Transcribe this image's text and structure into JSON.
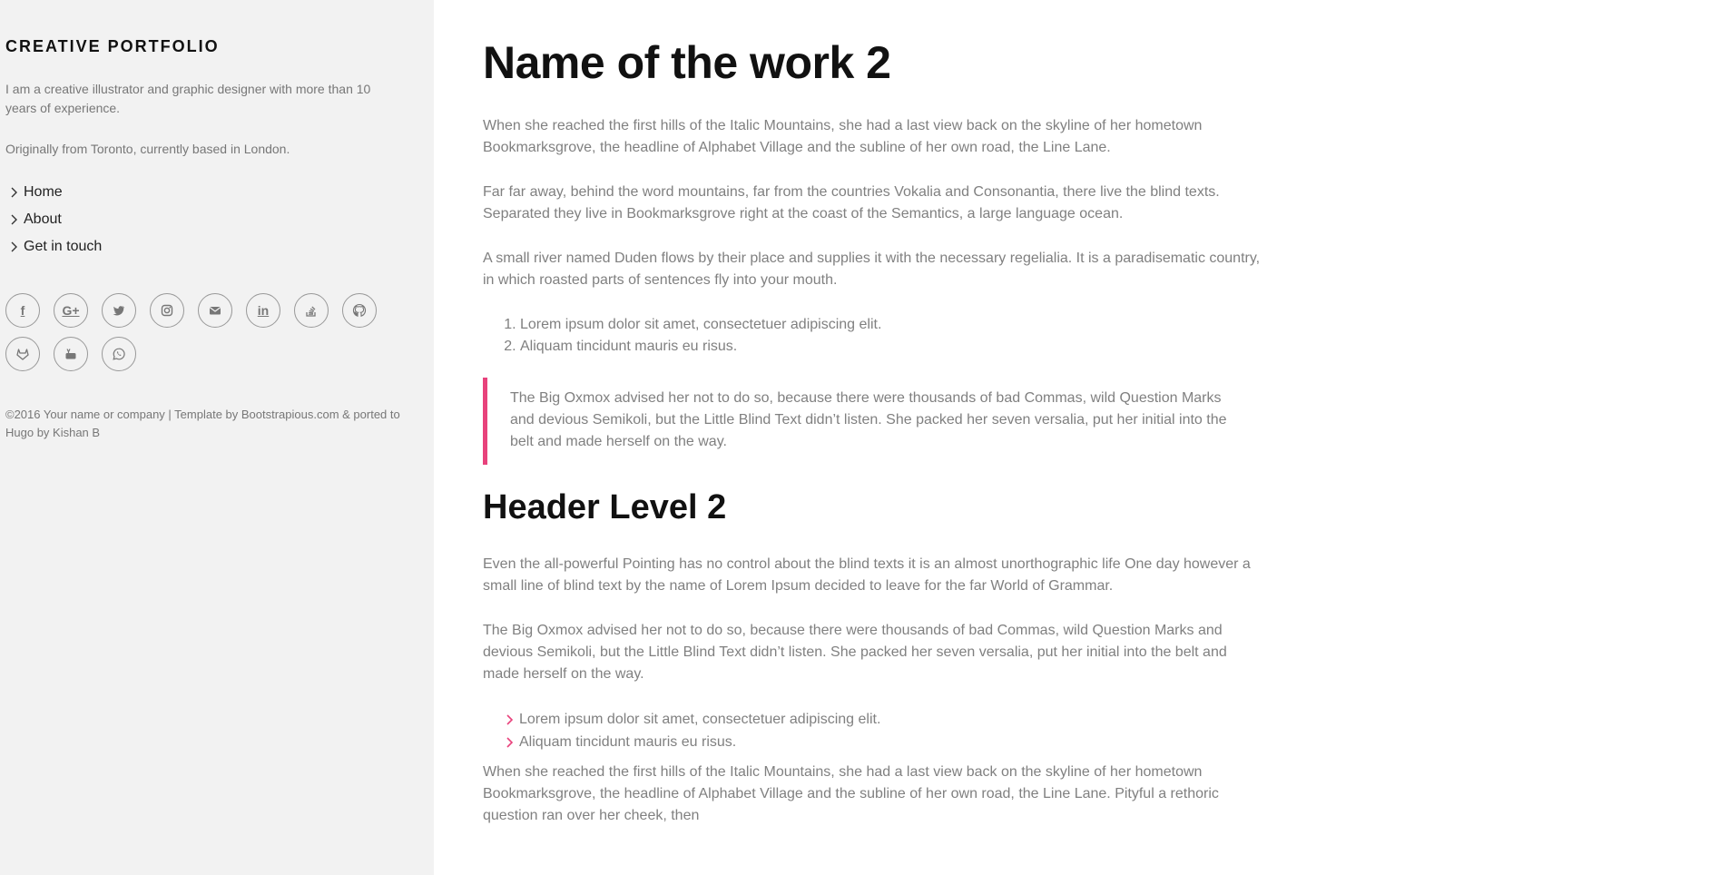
{
  "sidebar": {
    "brand": "CREATIVE PORTFOLIO",
    "intro": "I am a creative illustrator and graphic designer with more than 10 years of experience.",
    "location": "Originally from Toronto, currently based in London.",
    "nav": [
      {
        "label": "Home"
      },
      {
        "label": "About"
      },
      {
        "label": "Get in touch"
      }
    ],
    "social": [
      {
        "icon": "facebook-icon",
        "glyph": "f"
      },
      {
        "icon": "google-plus-icon",
        "glyph": "G+"
      },
      {
        "icon": "twitter-icon",
        "glyph": ""
      },
      {
        "icon": "instagram-icon",
        "glyph": ""
      },
      {
        "icon": "email-icon",
        "glyph": ""
      },
      {
        "icon": "linkedin-icon",
        "glyph": "in"
      },
      {
        "icon": "stack-overflow-icon",
        "glyph": ""
      },
      {
        "icon": "github-icon",
        "glyph": ""
      },
      {
        "icon": "gitlab-icon",
        "glyph": ""
      },
      {
        "icon": "youtube-icon",
        "glyph": ""
      },
      {
        "icon": "whatsapp-icon",
        "glyph": ""
      }
    ],
    "copyright": "©2016 Your name or company | Template by Bootstrapious.com & ported to Hugo by Kishan B"
  },
  "main": {
    "title": "Name of the work 2",
    "paragraphs": [
      "When she reached the first hills of the Italic Mountains, she had a last view back on the skyline of her hometown Bookmarksgrove, the headline of Alphabet Village and the subline of her own road, the Line Lane.",
      "Far far away, behind the word mountains, far from the countries Vokalia and Consonantia, there live the blind texts. Separated they live in Bookmarksgrove right at the coast of the Semantics, a large language ocean.",
      "A small river named Duden flows by their place and supplies it with the necessary regelialia. It is a paradisematic country, in which roasted parts of sentences fly into your mouth."
    ],
    "ordered_list": [
      "Lorem ipsum dolor sit amet, consectetuer adipiscing elit.",
      "Aliquam tincidunt mauris eu risus."
    ],
    "blockquote": "The Big Oxmox advised her not to do so, because there were thousands of bad Commas, wild Question Marks and devious Semikoli, but the Little Blind Text didn’t listen. She packed her seven versalia, put her initial into the belt and made herself on the way.",
    "header2": "Header Level 2",
    "paragraphs2": [
      "Even the all-powerful Pointing has no control about the blind texts it is an almost unorthographic life One day however a small line of blind text by the name of Lorem Ipsum decided to leave for the far World of Grammar.",
      "The Big Oxmox advised her not to do so, because there were thousands of bad Commas, wild Question Marks and devious Semikoli, but the Little Blind Text didn’t listen. She packed her seven versalia, put her initial into the belt and made herself on the way."
    ],
    "unordered_list": [
      "Lorem ipsum dolor sit amet, consectetuer adipiscing elit.",
      "Aliquam tincidunt mauris eu risus."
    ],
    "final_paragraph": "When she reached the first hills of the Italic Mountains, she had a last view back on the skyline of her hometown Bookmarksgrove, the headline of Alphabet Village and the subline of her own road, the Line Lane. Pityful a rethoric question ran over her cheek, then"
  },
  "colors": {
    "accent": "#e8427c",
    "sidebar_bg": "#f2f2f2",
    "text_gray": "#808080",
    "heading": "#111111"
  }
}
